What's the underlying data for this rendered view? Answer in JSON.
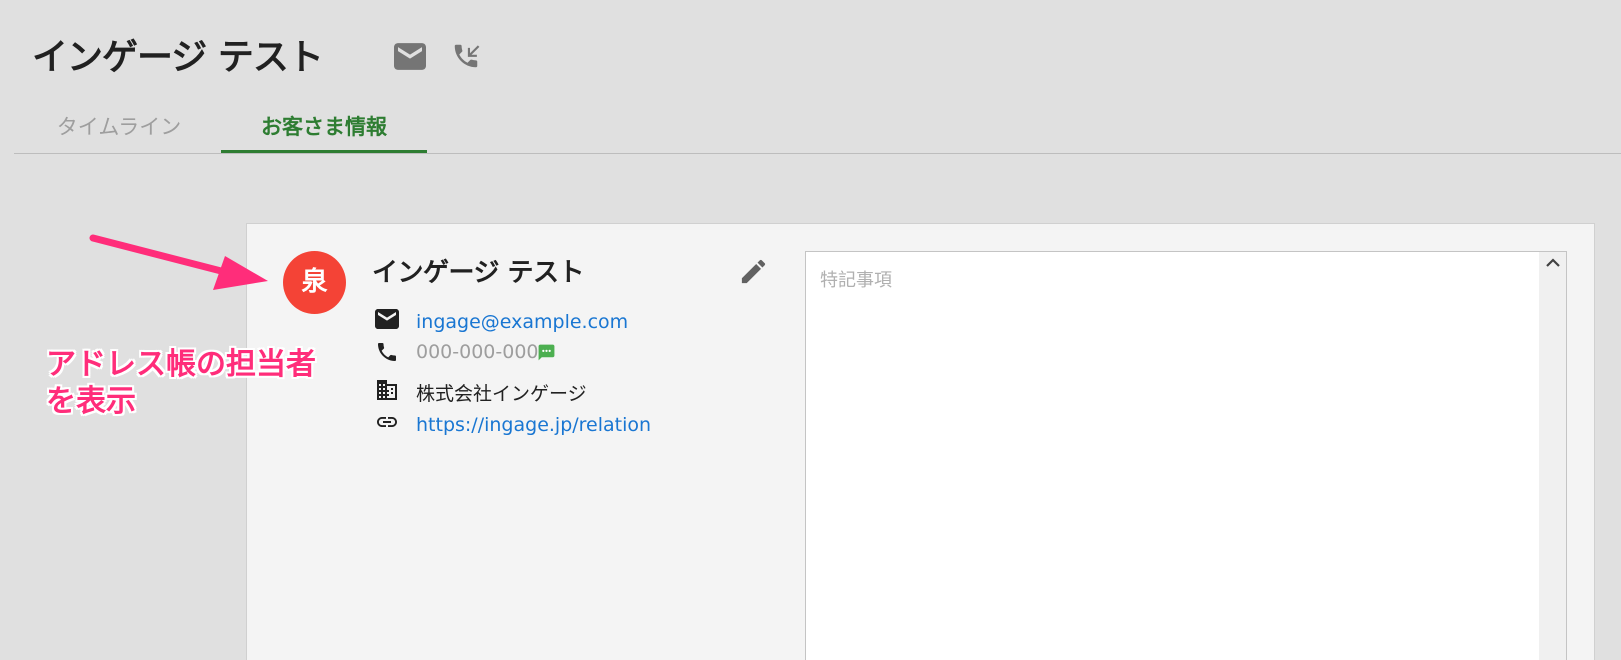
{
  "header": {
    "title": "インゲージ テスト",
    "icons": [
      "email-icon",
      "phone-callback-icon"
    ]
  },
  "tabs": [
    {
      "label": "タイムライン",
      "active": false
    },
    {
      "label": "お客さま情報",
      "active": true
    }
  ],
  "colors": {
    "accent": "#2e7d32",
    "avatar": "#f44336",
    "link": "#1976d2",
    "annotation": "#ff2d7a",
    "sms": "#4caf50"
  },
  "contact": {
    "avatar_initial": "泉",
    "name": "インゲージ テスト",
    "email": "ingage@example.com",
    "phone": "000-000-000",
    "company": "株式会社インゲージ",
    "url": "https://ingage.jp/relation"
  },
  "notes": {
    "placeholder": "特記事項"
  },
  "annotation": {
    "line1": "アドレス帳の担当者",
    "line2": "を表示"
  }
}
